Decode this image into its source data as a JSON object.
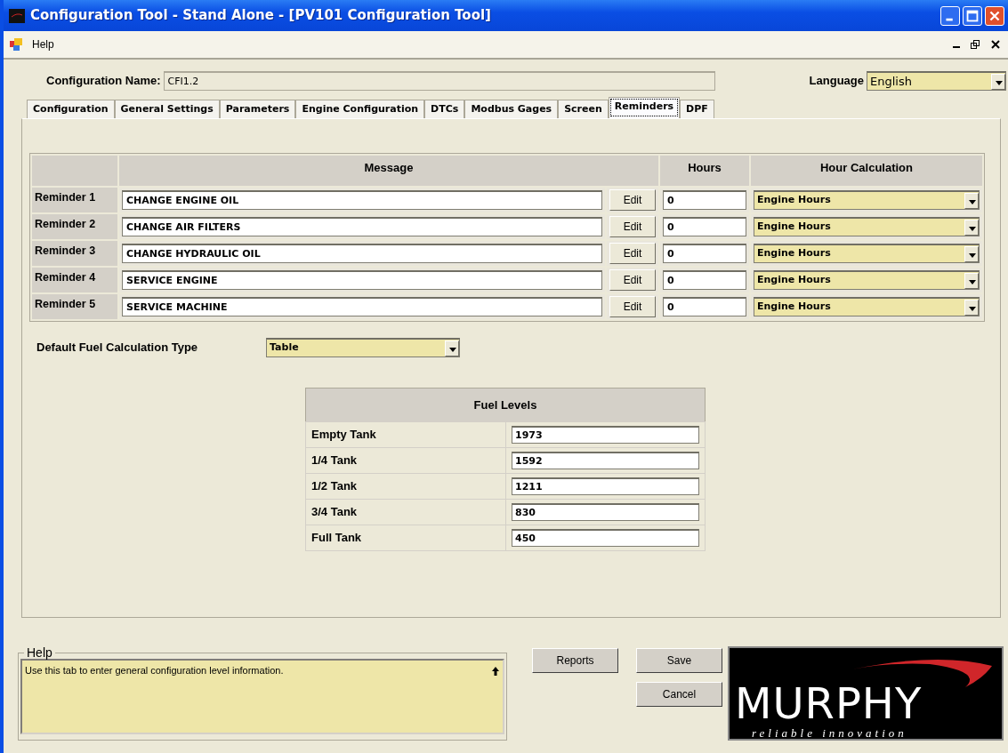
{
  "window": {
    "title": "Configuration Tool - Stand Alone - [PV101 Configuration Tool]"
  },
  "menu": [
    {
      "label": "Help"
    }
  ],
  "config_name": {
    "label": "Configuration Name:",
    "value": "CFI1.2"
  },
  "language": {
    "label": "Language",
    "value": "English"
  },
  "tabs": [
    {
      "label": "Configuration",
      "selected": false
    },
    {
      "label": "General Settings",
      "selected": false
    },
    {
      "label": "Parameters",
      "selected": false
    },
    {
      "label": "Engine Configuration",
      "selected": false
    },
    {
      "label": "DTCs",
      "selected": false
    },
    {
      "label": "Modbus Gages",
      "selected": false
    },
    {
      "label": "Screen",
      "selected": false
    },
    {
      "label": "Reminders",
      "selected": true
    },
    {
      "label": "DPF",
      "selected": false
    }
  ],
  "reminders": {
    "columns": [
      "Message",
      "Hours",
      "Hour Calculation"
    ],
    "rows": [
      {
        "label": "Reminder 1",
        "message": "CHANGE ENGINE OIL",
        "edit": "Edit",
        "hours": "0",
        "calculation": "Engine Hours"
      },
      {
        "label": "Reminder 2",
        "message": "CHANGE AIR FILTERS",
        "edit": "Edit",
        "hours": "0",
        "calculation": "Engine Hours"
      },
      {
        "label": "Reminder 3",
        "message": "CHANGE HYDRAULIC OIL",
        "edit": "Edit",
        "hours": "0",
        "calculation": "Engine Hours"
      },
      {
        "label": "Reminder 4",
        "message": "SERVICE ENGINE",
        "edit": "Edit",
        "hours": "0",
        "calculation": "Engine Hours"
      },
      {
        "label": "Reminder 5",
        "message": "SERVICE MACHINE",
        "edit": "Edit",
        "hours": "0",
        "calculation": "Engine Hours"
      }
    ]
  },
  "fuel_calc": {
    "label": "Default Fuel Calculation Type",
    "value": "Table"
  },
  "fuel_levels": {
    "title": "Fuel Levels",
    "rows": [
      {
        "label": "Empty Tank",
        "value": "1973"
      },
      {
        "label": "1/4 Tank",
        "value": "1592"
      },
      {
        "label": "1/2 Tank",
        "value": "1211"
      },
      {
        "label": "3/4 Tank",
        "value": "830"
      },
      {
        "label": "Full Tank",
        "value": "450"
      }
    ]
  },
  "help": {
    "title": "Help",
    "text": "Use this tab to enter general configuration level information."
  },
  "buttons": {
    "reports": "Reports",
    "save": "Save",
    "cancel": "Cancel"
  },
  "logo": {
    "name": "MURPHY",
    "tagline": "reliable innovation"
  }
}
